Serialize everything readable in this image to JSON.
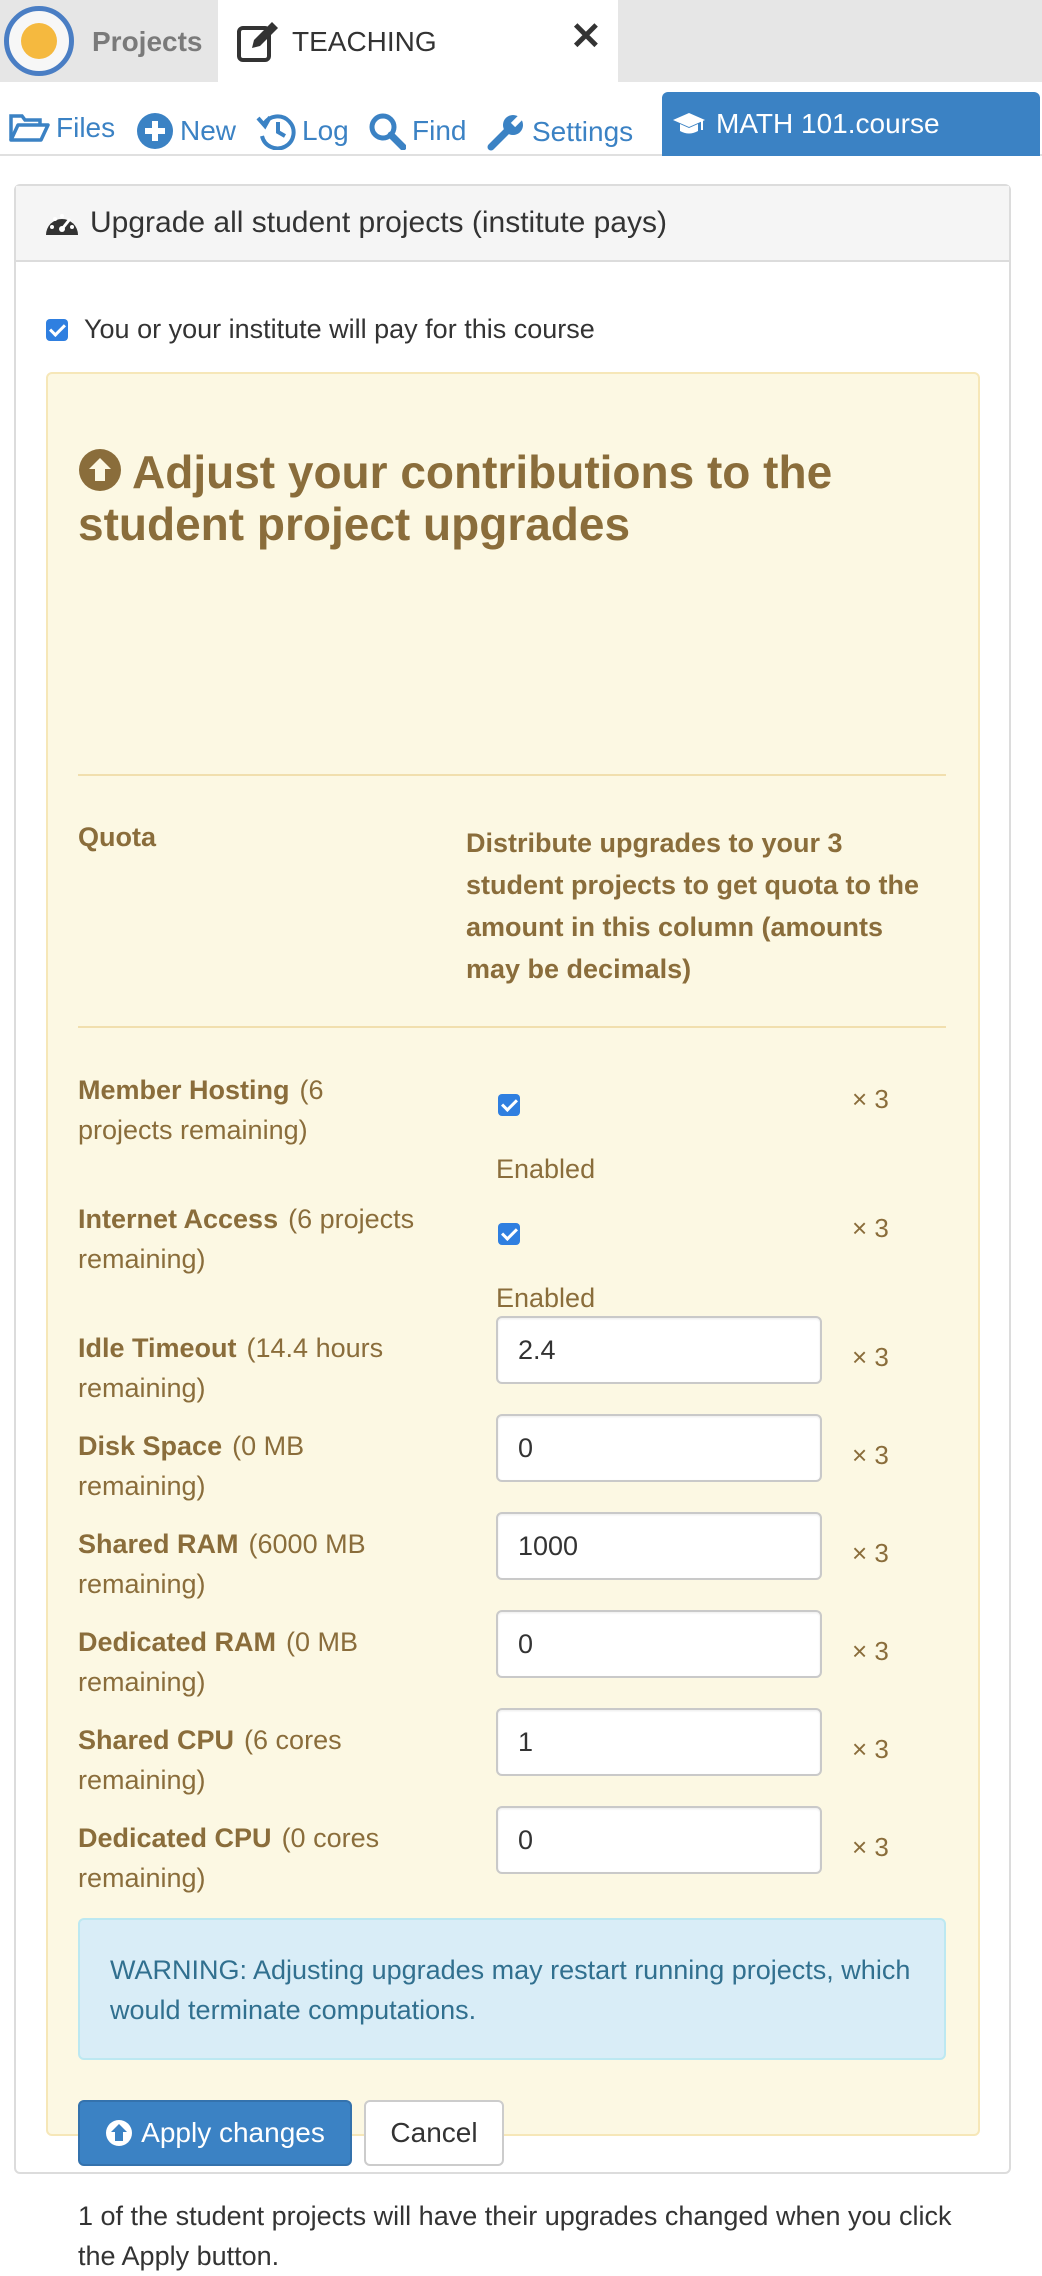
{
  "topbar": {
    "projects_label": "Projects",
    "active_tab_label": "TEACHING",
    "close_glyph": "✕"
  },
  "nav": {
    "files": "Files",
    "new": "New",
    "log": "Log",
    "find": "Find",
    "settings": "Settings",
    "course_tab": "MATH 101.course"
  },
  "panel": {
    "heading": "Upgrade all student projects (institute pays)",
    "pay_checkbox_checked": true,
    "pay_label": "You or your institute will pay for this course"
  },
  "contrib": {
    "title": "Adjust your contributions to the student project upgrades",
    "col_quota": "Quota",
    "col_distribute": "Distribute upgrades to your 3 student projects to get quota to the amount in this column (amounts may be decimals)",
    "multiplier": "× 3",
    "enabled_label": "Enabled",
    "quotas": [
      {
        "name": "Member Hosting",
        "remaining": "(6 projects remaining)",
        "checked": true
      },
      {
        "name": "Internet Access",
        "remaining": "(6 projects remaining)",
        "checked": true
      },
      {
        "name": "Idle Timeout",
        "remaining": "(14.4 hours remaining)",
        "value": "2.4"
      },
      {
        "name": "Disk Space",
        "remaining": "(0 MB remaining)",
        "value": "0"
      },
      {
        "name": "Shared RAM",
        "remaining": "(6000 MB remaining)",
        "value": "1000"
      },
      {
        "name": "Dedicated RAM",
        "remaining": "(0 MB remaining)",
        "value": "0"
      },
      {
        "name": "Shared CPU",
        "remaining": "(6 cores remaining)",
        "value": "1"
      },
      {
        "name": "Dedicated CPU",
        "remaining": "(0 cores remaining)",
        "value": "0"
      }
    ],
    "warning": "WARNING: Adjusting upgrades may restart running projects, which would terminate computations.",
    "apply_label": "Apply changes",
    "cancel_label": "Cancel",
    "footnote": "1 of the student projects will have their upgrades changed when you click the Apply button."
  },
  "colors": {
    "accent": "#3b82c4",
    "warning_bg": "#fcf8e3",
    "warning_text": "#8a6d3b",
    "info_bg": "#d9edf7",
    "info_text": "#31708f"
  },
  "icons": {
    "logo": "cocalc-logo-icon",
    "teaching": "edit-icon",
    "files": "folder-open-icon",
    "new": "plus-circle-icon",
    "log": "history-icon",
    "find": "search-icon",
    "settings": "wrench-icon",
    "course": "graduation-cap-icon",
    "heading": "dashboard-icon",
    "title": "arrow-circle-up-icon"
  }
}
